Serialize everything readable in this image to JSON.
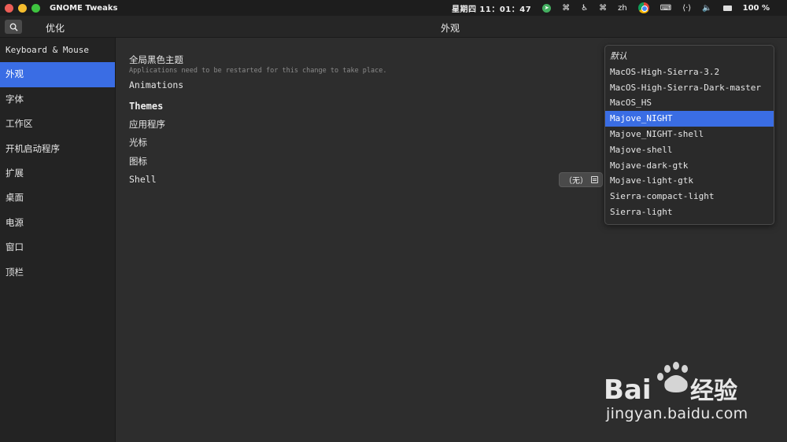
{
  "system": {
    "app_name": "GNOME Tweaks",
    "clock": "星期四 11：01：47",
    "lang": "zh",
    "battery": "100 %",
    "traffic_colors": [
      "#ed5e57",
      "#f5bd2e",
      "#3ec43f"
    ]
  },
  "header": {
    "left_title": "优化",
    "main_title": "外观"
  },
  "sidebar": {
    "items": [
      {
        "label": "Keyboard & Mouse",
        "mono": true,
        "active": false
      },
      {
        "label": "外观",
        "active": true
      },
      {
        "label": "字体",
        "active": false
      },
      {
        "label": "工作区",
        "active": false
      },
      {
        "label": "开机启动程序",
        "active": false
      },
      {
        "label": "扩展",
        "active": false
      },
      {
        "label": "桌面",
        "active": false
      },
      {
        "label": "电源",
        "active": false
      },
      {
        "label": "窗口",
        "active": false
      },
      {
        "label": "顶栏",
        "active": false
      }
    ]
  },
  "content": {
    "dark_theme_label": "全局黑色主题",
    "dark_theme_note": "Applications need to be restarted for this change to take place.",
    "animations_label": "Animations",
    "themes_heading": "Themes",
    "applications_label": "应用程序",
    "cursor_label": "光标",
    "icons_label": "图标",
    "shell_label": "Shell",
    "shell_value": "（无）"
  },
  "dropdown": {
    "options": [
      {
        "label": "默认",
        "italic": true
      },
      {
        "label": "MacOS-High-Sierra-3.2"
      },
      {
        "label": "MacOS-High-Sierra-Dark-master"
      },
      {
        "label": "MacOS_HS"
      },
      {
        "label": "Majove_NIGHT",
        "selected": true
      },
      {
        "label": "Majove_NIGHT-shell"
      },
      {
        "label": "Majove-shell"
      },
      {
        "label": "Mojave-dark-gtk"
      },
      {
        "label": "Mojave-light-gtk"
      },
      {
        "label": "Sierra-compact-light"
      },
      {
        "label": "Sierra-light"
      }
    ],
    "accent": "#3a6de4"
  },
  "watermark": {
    "url_text": "jingyan.baidu.com"
  }
}
